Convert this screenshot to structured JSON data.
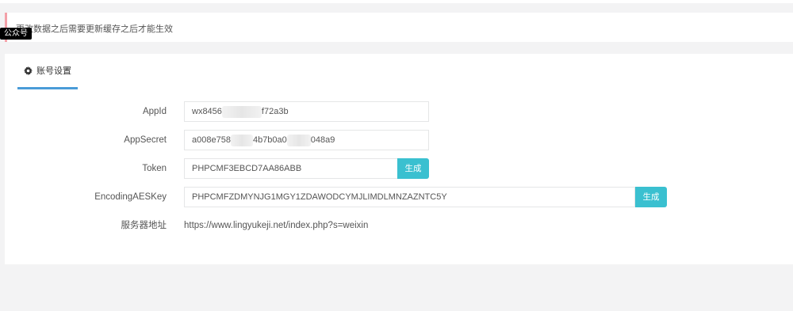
{
  "notice": {
    "text": "更改数据之后需要更新缓存之后才能生效"
  },
  "tooltip": {
    "text": "公众号"
  },
  "tab": {
    "icon": "gear-icon",
    "label": "账号设置"
  },
  "fields": {
    "appid": {
      "label": "AppId",
      "value_start": "wx8456",
      "value_end": "f72a3b"
    },
    "appsecret": {
      "label": "AppSecret",
      "value_start": "a008e758",
      "value_mid": "4b7b0a0",
      "value_end": "048a9"
    },
    "token": {
      "label": "Token",
      "value": "PHPCMF3EBCD7AA86ABB",
      "button": "生成"
    },
    "aeskey": {
      "label": "EncodingAESKey",
      "value": "PHPCMFZDMYNJG1MGY1ZDAWODCYMJLIMDLMNZAZNTC5Y",
      "button": "生成"
    },
    "server": {
      "label": "服务器地址",
      "value": "https://www.lingyukeji.net/index.php?s=weixin"
    }
  },
  "colors": {
    "accent": "#3ac0d0",
    "tab_underline": "#4a9cd8",
    "notice_bar": "#f3a0a8"
  }
}
